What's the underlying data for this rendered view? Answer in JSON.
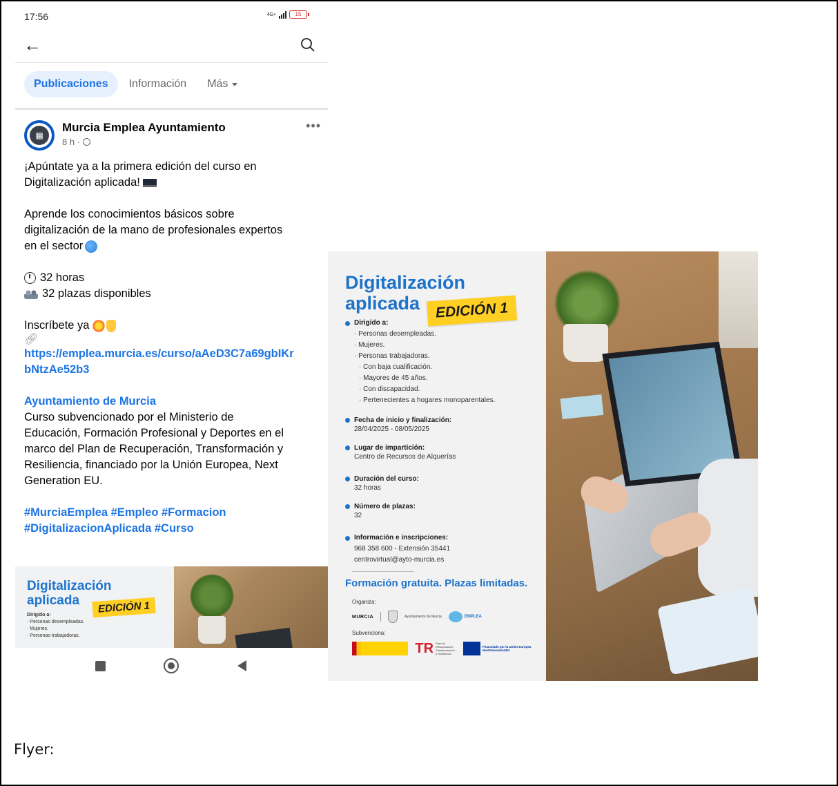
{
  "status_bar": {
    "time": "17:56",
    "network": "4G+",
    "battery": "15"
  },
  "tabs": {
    "posts": "Publicaciones",
    "info": "Información",
    "more": "Más"
  },
  "post": {
    "author": "Murcia Emplea Ayuntamiento",
    "time": "8 h ·",
    "intro_line1": "¡Apúntate ya a la primera edición del curso en",
    "intro_line2": "Digitalización aplicada!",
    "learn_line1": "Aprende los conocimientos básicos sobre",
    "learn_line2": "digitalización de la mano de profesionales expertos",
    "learn_line3": "en el sector",
    "hours": "32 horas",
    "places": "32 plazas disponibles",
    "signup": "Inscríbete ya",
    "link_line1": "https://emplea.murcia.es/curso/aAeD3C7a69gbIKr",
    "link_line2": "bNtzAe52b3",
    "org_tag": "Ayuntamiento de Murcia",
    "funding_line1": "Curso subvencionado por el Ministerio de",
    "funding_line2": "Educación, Formación Profesional y Deportes en el",
    "funding_line3": "marco del Plan de Recuperación, Transformación y",
    "funding_line4": "Resiliencia, financiado por la Unión Europea, Next",
    "funding_line5": "Generation EU.",
    "hashtags_line1": "#MurciaEmplea #Empleo #Formacion",
    "hashtags_line2": "#DigitalizacionAplicada #Curso"
  },
  "preview": {
    "title_line1": "Digitalización",
    "title_line2": "aplicada",
    "badge": "EDICIÓN 1",
    "head": "Dirigido a:",
    "item1": "· Personas desempleadas.",
    "item2": "· Mujeres.",
    "item3": "· Personas trabajadoras."
  },
  "flyer": {
    "title_line1": "Digitalización",
    "title_line2": "aplicada",
    "badge": "EDICIÓN 1",
    "audience_head": "Dirigido a:",
    "audience": [
      "· Personas desempleadas.",
      "· Mujeres.",
      "· Personas trabajadoras.",
      "· Con baja cualificación.",
      "· Mayores de 45 años.",
      "· Con discapacidad.",
      "· Pertenecientes a hogares monoparentales."
    ],
    "dates_head": "Fecha de inicio y finalización:",
    "dates": "28/04/2025 - 08/05/2025",
    "place_head": "Lugar de impartición:",
    "place": "Centro de Recursos de Alquerías",
    "duration_head": "Duración del curso:",
    "duration": "32 horas",
    "seats_head": "Número de plazas:",
    "seats": "32",
    "contact_head": "Información e inscripciones:",
    "phone": "968 358 600 - Extensión 35441",
    "email": "centrovirtual@ayto-murcia.es",
    "free": "Formación gratuita. Plazas limitadas.",
    "organiza": "Organiza:",
    "murcia_logo": "MURCIA",
    "ayto_logo": "Ayuntamiento de Murcia",
    "emplea_logo": "EMPLEA",
    "subvenciona": "Subvenciona:",
    "prtr_logo": "Plan de Recuperación, Transformación y Resiliencia",
    "eu_logo": "Financiado por la Unión Europea NextGenerationEU"
  },
  "caption": "Flyer:"
}
